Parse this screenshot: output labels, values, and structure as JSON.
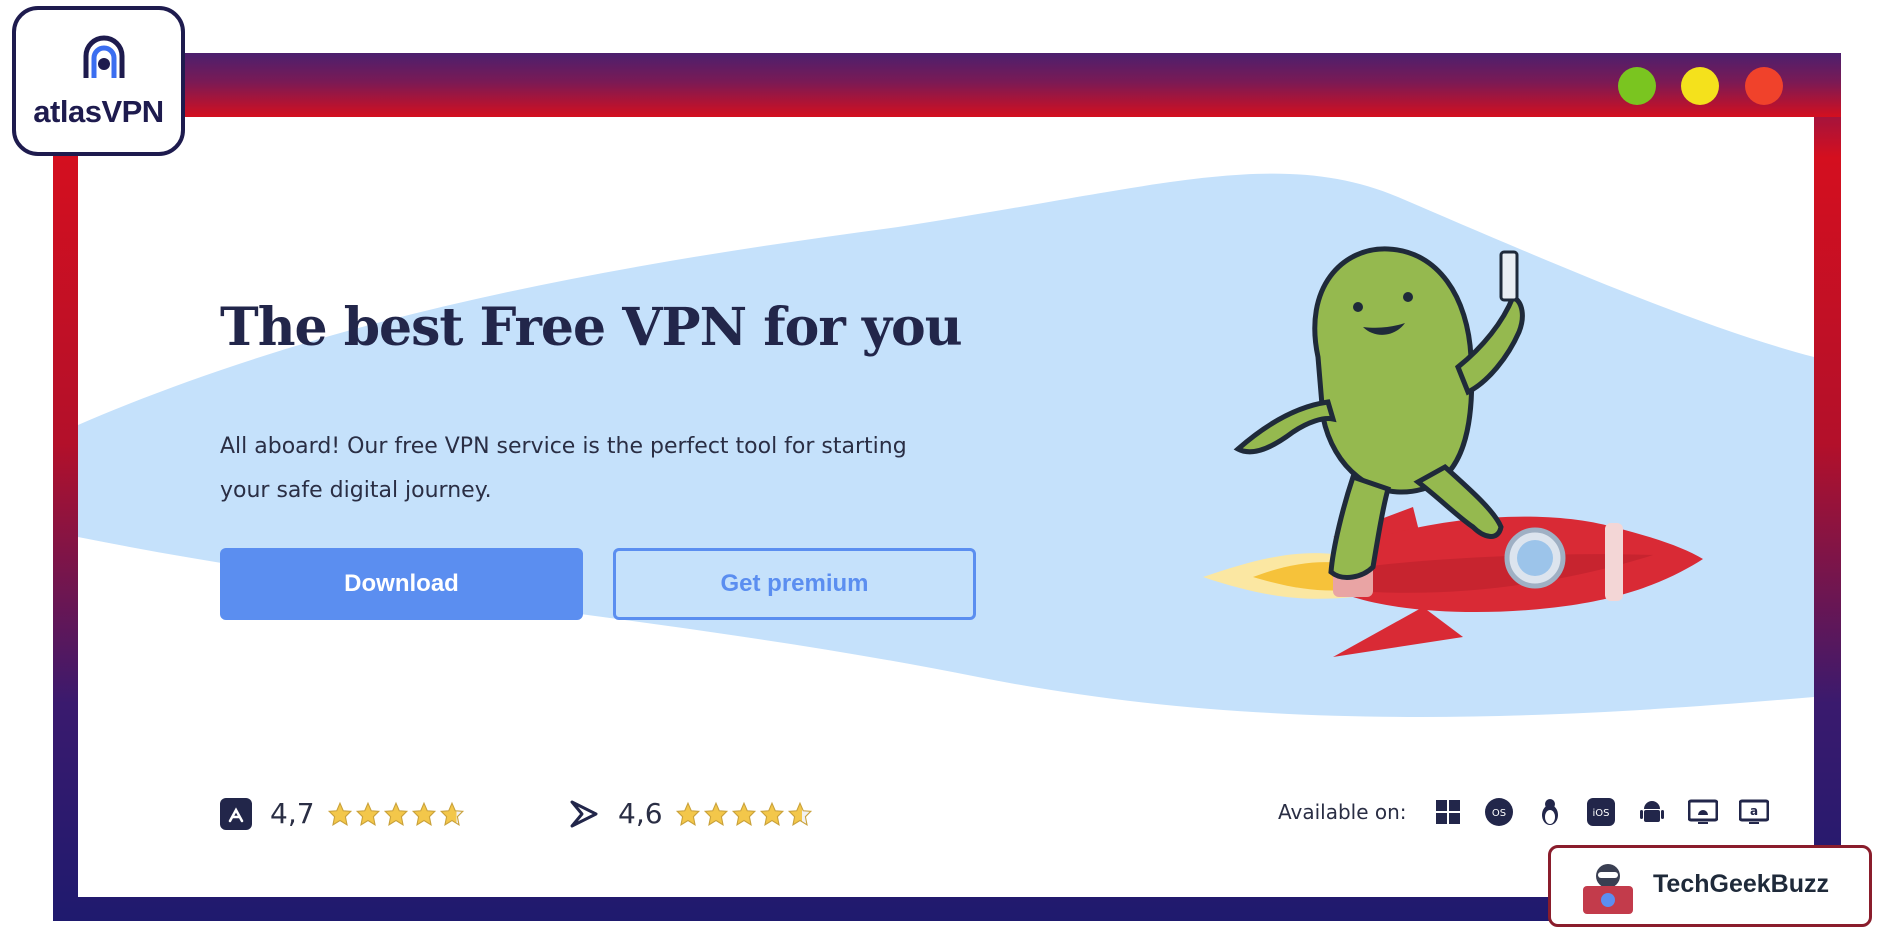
{
  "brand": {
    "name": "atlasVPN"
  },
  "window": {
    "controls": [
      "green-dot",
      "yellow-dot",
      "red-dot"
    ]
  },
  "hero": {
    "title": "The best Free VPN for you",
    "subtitle": "All aboard! Our free VPN service is the perfect tool for starting your safe digital journey.",
    "download_label": "Download",
    "premium_label": "Get premium"
  },
  "ratings": {
    "app_store": {
      "icon": "app-store-icon",
      "value": "4,7",
      "stars": 4.7
    },
    "google_play": {
      "icon": "google-play-icon",
      "value": "4,6",
      "stars": 4.6
    }
  },
  "availability": {
    "label": "Available on:",
    "platforms": [
      "windows-icon",
      "macos-icon",
      "linux-icon",
      "ios-icon",
      "android-icon",
      "android-tv-icon",
      "amazon-fire-tv-icon"
    ]
  },
  "watermark": {
    "text": "TechGeekBuzz"
  },
  "colors": {
    "accent": "#5b8ef0",
    "headline": "#22264a",
    "wave": "#c5e1fb",
    "frame_red": "#d40f1f",
    "frame_navy": "#1f1a6e",
    "star": "#f3c74a"
  }
}
